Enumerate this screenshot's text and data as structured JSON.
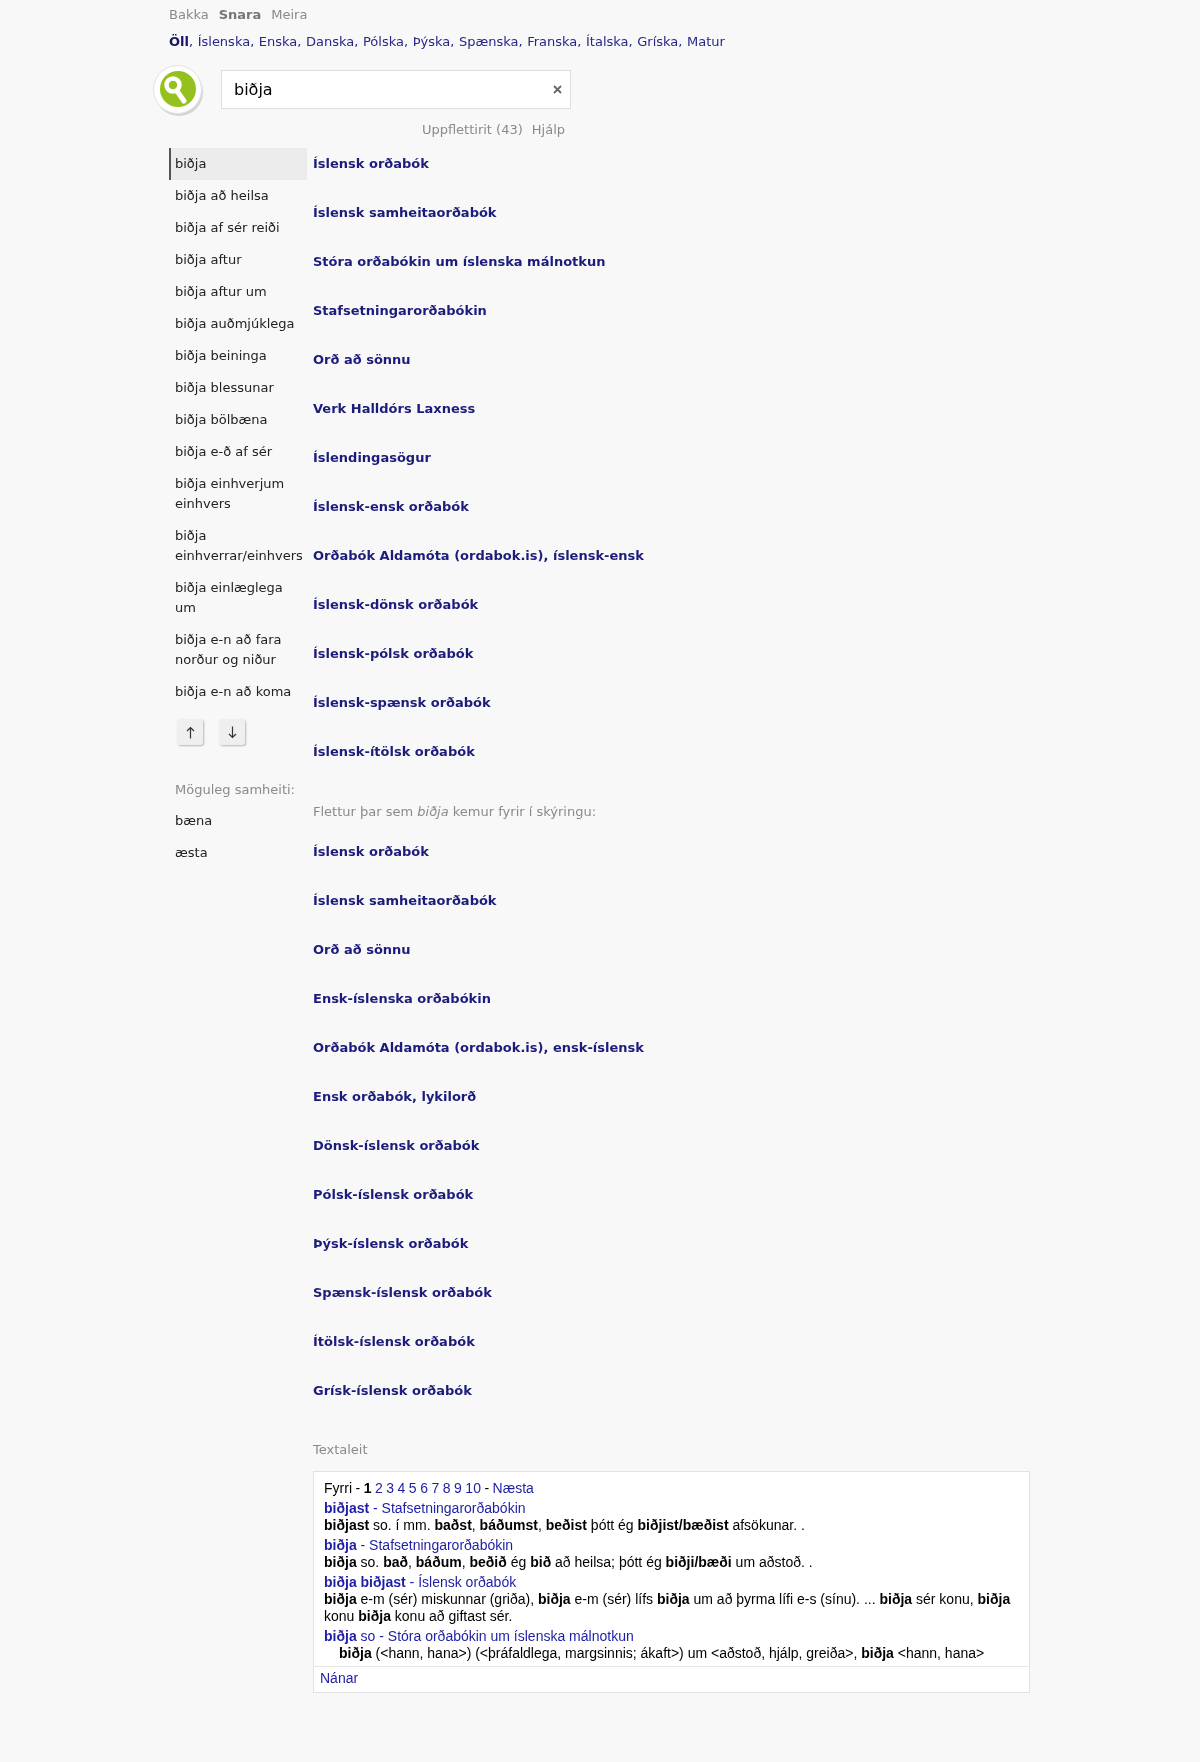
{
  "nav": {
    "items": [
      {
        "label": "Bakka",
        "selected": false
      },
      {
        "label": "Snara",
        "selected": true
      },
      {
        "label": "Meira",
        "selected": false
      }
    ]
  },
  "languages": {
    "separator": ",",
    "items": [
      {
        "label": "Öll",
        "selected": true
      },
      {
        "label": "Íslenska",
        "selected": false
      },
      {
        "label": "Enska",
        "selected": false
      },
      {
        "label": "Danska",
        "selected": false
      },
      {
        "label": "Pólska",
        "selected": false
      },
      {
        "label": "Þýska",
        "selected": false
      },
      {
        "label": "Spænska",
        "selected": false
      },
      {
        "label": "Franska",
        "selected": false
      },
      {
        "label": "Ítalska",
        "selected": false
      },
      {
        "label": "Gríska",
        "selected": false
      },
      {
        "label": "Matur",
        "selected": false
      }
    ]
  },
  "search": {
    "value": "biðja"
  },
  "links": [
    "Uppflettirit (43)",
    "Hjálp"
  ],
  "entries": [
    {
      "label": "biðja",
      "selected": true
    },
    {
      "label": "biðja að heilsa",
      "selected": false
    },
    {
      "label": "biðja af sér reiði",
      "selected": false
    },
    {
      "label": "biðja aftur",
      "selected": false
    },
    {
      "label": "biðja aftur um",
      "selected": false
    },
    {
      "label": "biðja auðmjúklega",
      "selected": false
    },
    {
      "label": "biðja beininga",
      "selected": false
    },
    {
      "label": "biðja blessunar",
      "selected": false
    },
    {
      "label": "biðja bölbæna",
      "selected": false
    },
    {
      "label": "biðja e-ð af sér",
      "selected": false
    },
    {
      "label": "biðja einhverjum einhvers",
      "selected": false
    },
    {
      "label": "biðja einhverrar/einhvers",
      "selected": false
    },
    {
      "label": "biðja einlæglega um",
      "selected": false
    },
    {
      "label": "biðja e-n að fara norður og niður",
      "selected": false
    },
    {
      "label": "biðja e-n að koma",
      "selected": false
    }
  ],
  "synonyms": {
    "heading": "Möguleg samheiti:",
    "items": [
      "bæna",
      "æsta"
    ]
  },
  "results": [
    "Íslensk orðabók",
    "Íslensk samheitaorðabók",
    "Stóra orðabókin um íslenska málnotkun",
    "Stafsetningarorðabókin",
    "Orð að sönnu",
    "Verk Halldórs Laxness",
    "Íslendingasögur",
    "Íslensk-ensk orðabók",
    "Orðabók Aldamóta (ordabok.is), íslensk-ensk",
    "Íslensk-dönsk orðabók",
    "Íslensk-pólsk orðabók",
    "Íslensk-spænsk orðabók",
    "Íslensk-ítölsk orðabók"
  ],
  "definition_results": {
    "heading": "Flettur þar sem *biðja* kemur fyrir í skýringu:",
    "items": [
      "Íslensk orðabók",
      "Íslensk samheitaorðabók",
      "Orð að sönnu",
      "Ensk-íslenska orðabókin",
      "Orðabók Aldamóta (ordabok.is), ensk-íslensk",
      "Ensk orðabók, lykilorð",
      "Dönsk-íslensk orðabók",
      "Pólsk-íslensk orðabók",
      "Þýsk-íslensk orðabók",
      "Spænsk-íslensk orðabók",
      "Ítölsk-íslensk orðabók",
      "Grísk-íslensk orðabók"
    ]
  },
  "text_search": {
    "heading": "Textaleit",
    "pagination": {
      "previous": {
        "label": "Fyrri",
        "disabled": true
      },
      "separator": "-",
      "pages": [
        {
          "label": "1",
          "selected": true
        },
        {
          "label": "2",
          "selected": false
        },
        {
          "label": "3",
          "selected": false
        },
        {
          "label": "4",
          "selected": false
        },
        {
          "label": "5",
          "selected": false
        },
        {
          "label": "6",
          "selected": false
        },
        {
          "label": "7",
          "selected": false
        },
        {
          "label": "8",
          "selected": false
        },
        {
          "label": "9",
          "selected": false
        },
        {
          "label": "10",
          "selected": false
        }
      ],
      "next": {
        "label": "Næsta",
        "disabled": false
      }
    },
    "hits": [
      {
        "title": "**biðjast** - Stafsetningarorðabókin",
        "body": "**biðjast** so. í mm. **baðst**, **báðumst**, **beðist** þótt ég **biðjist/bæðist** afsökunar. .",
        "indented": false
      },
      {
        "title": "**biðja** - Stafsetningarorðabókin",
        "body": "**biðja** so. **bað**, **báðum**, **beðið** ég **bið** að heilsa; þótt ég **biðji/bæði** um aðstoð. .",
        "indented": false
      },
      {
        "title": "**biðja biðjast** - Íslensk orðabók",
        "body": "**biðja** e-m (sér) miskunnar (griða), **biðja** e-m (sér) lífs **biðja** um að þyrma lífi e-s (sínu). ... **biðja** sér konu, **biðja** konu **biðja** konu að giftast sér.",
        "indented": false
      },
      {
        "title": "**biðja** so - Stóra orðabókin um íslenska málnotkun",
        "body": "**biðja** (<hann, hana>) (<þráfaldlega, margsinnis; ákaft>) um <aðstoð, hjálp, greiða>, **biðja** <hann, hana>",
        "indented": true
      }
    ],
    "more": "Nánar"
  }
}
